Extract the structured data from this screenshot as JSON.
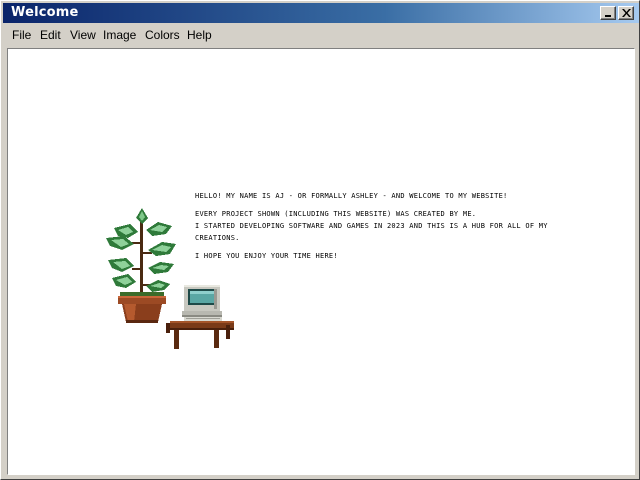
{
  "window": {
    "title": "Welcome"
  },
  "menu": {
    "items": [
      "File",
      "Edit",
      "View",
      "Image",
      "Colors",
      "Help"
    ]
  },
  "content": {
    "intro": "HELLO! MY NAME IS AJ - OR FORMALLY ASHLEY - AND WELCOME TO MY WEBSITE!",
    "line1": "EVERY PROJECT SHOWN (INCLUDING THIS WEBSITE) WAS CREATED BY ME.",
    "line2": "I STARTED DEVELOPING SOFTWARE AND GAMES IN 2023 AND THIS IS A HUB FOR ALL OF MY CREATIONS.",
    "closing": "I HOPE YOU ENJOY YOUR TIME HERE!"
  },
  "icons": {
    "plant": "potted-plant-icon",
    "computer": "computer-on-desk-icon",
    "minimize": "minimize-icon",
    "close": "close-icon"
  },
  "colors": {
    "titlebar_start": "#0a246a",
    "titlebar_end": "#a6caf0",
    "window_bg": "#d4d0c8",
    "canvas_bg": "#ffffff"
  }
}
